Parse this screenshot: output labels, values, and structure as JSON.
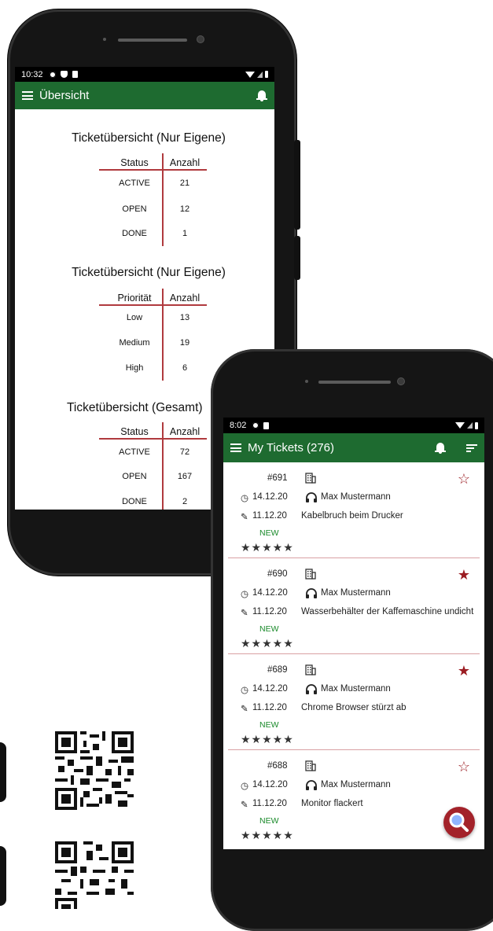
{
  "phone1": {
    "status_time": "10:32",
    "app_title": "Übersicht",
    "sections": [
      {
        "title": "Ticketübersicht (Nur Eigene)",
        "col1": "Status",
        "col2": "Anzahl",
        "rows": [
          {
            "label": "ACTIVE",
            "value": "21"
          },
          {
            "label": "OPEN",
            "value": "12"
          },
          {
            "label": "DONE",
            "value": "1"
          }
        ]
      },
      {
        "title": "Ticketübersicht (Nur Eigene)",
        "col1": "Priorität",
        "col2": "Anzahl",
        "rows": [
          {
            "label": "Low",
            "value": "13"
          },
          {
            "label": "Medium",
            "value": "19"
          },
          {
            "label": "High",
            "value": "6"
          }
        ]
      },
      {
        "title": "Ticketübersicht (Gesamt)",
        "col1": "Status",
        "col2": "Anzahl",
        "rows": [
          {
            "label": "ACTIVE",
            "value": "72"
          },
          {
            "label": "OPEN",
            "value": "167"
          },
          {
            "label": "DONE",
            "value": "2"
          }
        ]
      }
    ]
  },
  "phone2": {
    "status_time": "8:02",
    "app_title": "My Tickets (276)",
    "tickets": [
      {
        "number": "#691",
        "created": "14.12.20",
        "assignee": "Max Mustermann",
        "edited": "11.12.20",
        "subject": "Kabelbruch beim Drucker",
        "status": "NEW",
        "rating": "★★★★★",
        "starred": "☆"
      },
      {
        "number": "#690",
        "created": "14.12.20",
        "assignee": "Max Mustermann",
        "edited": "11.12.20",
        "subject": "Wasserbehälter der Kaffemaschine undicht",
        "status": "NEW",
        "rating": "★★★★★",
        "starred": "★"
      },
      {
        "number": "#689",
        "created": "14.12.20",
        "assignee": "Max Mustermann",
        "edited": "11.12.20",
        "subject": "Chrome Browser stürzt ab",
        "status": "NEW",
        "rating": "★★★★★",
        "starred": "★"
      },
      {
        "number": "#688",
        "created": "14.12.20",
        "assignee": "Max Mustermann",
        "edited": "11.12.20",
        "subject": "Monitor flackert",
        "status": "NEW",
        "rating": "★★★★★",
        "starred": "☆"
      }
    ]
  },
  "colors": {
    "appbar": "#1e6b30",
    "accent": "#a3222a",
    "divider": "#b03a3e",
    "status_new": "#1a8a2a"
  }
}
